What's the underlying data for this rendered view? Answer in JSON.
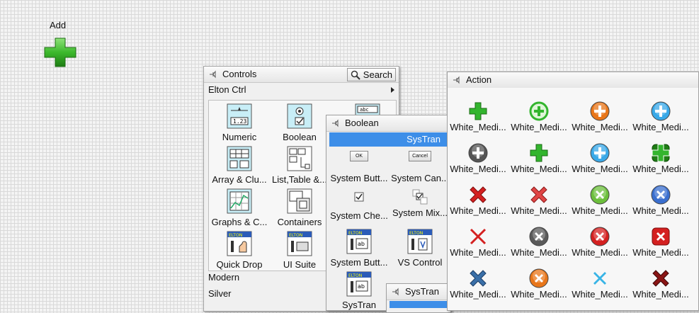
{
  "canvas": {
    "add_label": "Add"
  },
  "controls": {
    "title": "Controls",
    "search_label": "Search",
    "top_submenu": "Elton Ctrl",
    "items": [
      {
        "label": "Numeric"
      },
      {
        "label": "Boolean"
      },
      {
        "label": "Array & Clu..."
      },
      {
        "label": "List,Table &..."
      },
      {
        "label": "Graphs & C..."
      },
      {
        "label": "Containers"
      },
      {
        "label": "Quick Drop"
      },
      {
        "label": "UI Suite"
      }
    ],
    "bottom_items": [
      "Modern",
      "Silver"
    ]
  },
  "boolean": {
    "title": "Boolean",
    "selected_row": "SysTran",
    "items": [
      {
        "label": "System Butt...",
        "icon_text": "OK"
      },
      {
        "label": "System Can...",
        "icon_text": "Cancel"
      },
      {
        "label": "System Che..."
      },
      {
        "label": "System Mix..."
      },
      {
        "label": "System Butt..."
      },
      {
        "label": "VS Control"
      },
      {
        "label": "SysTran"
      }
    ]
  },
  "systran": {
    "title": "SysTran"
  },
  "action": {
    "title": "Action",
    "item_label": "White_Medi...",
    "icons": [
      "green-plus",
      "green-plus-circle",
      "orange-plus-circle",
      "blue-plus-circle",
      "gray-plus-circle",
      "green-plus",
      "blue-plus-circle",
      "green-plus-square",
      "red-x",
      "red-x-bold",
      "green-x-circle",
      "blue-x-circle",
      "red-x-thin",
      "gray-x-circle",
      "red-x-circle",
      "red-x-square",
      "blue-x",
      "orange-x-circle",
      "cyan-x",
      "darkred-x"
    ]
  },
  "colors": {
    "selection": "#3d8ee8",
    "green": "#33b52e",
    "orange": "#e8761a",
    "blue": "#3a6fcf",
    "red": "#d42020"
  }
}
